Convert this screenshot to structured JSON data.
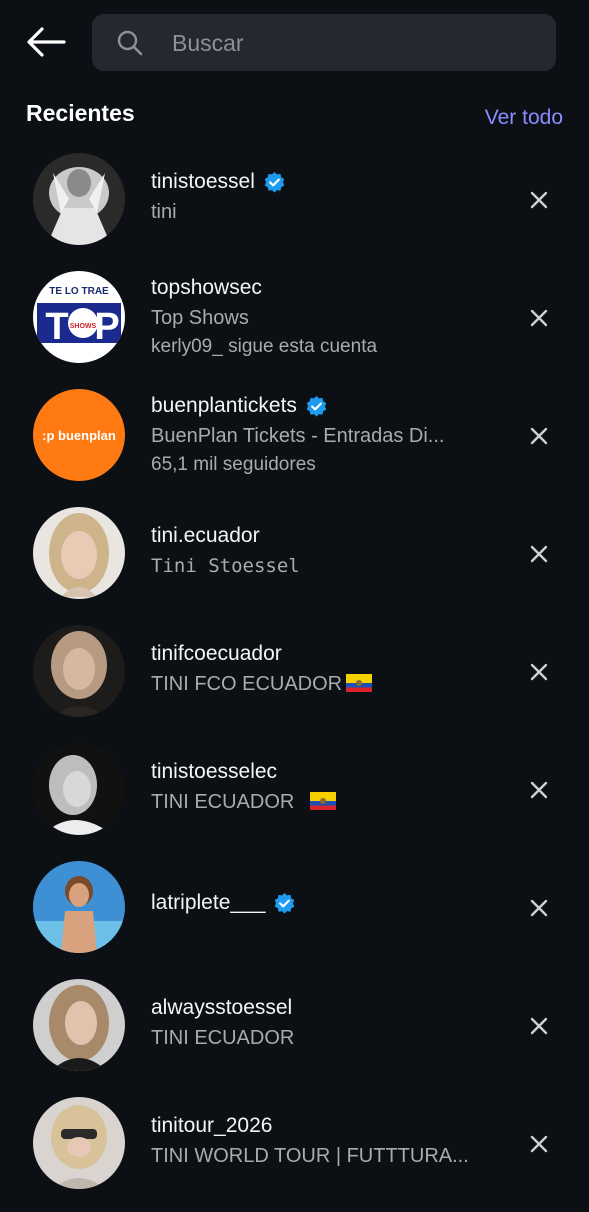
{
  "search": {
    "placeholder": "Buscar"
  },
  "section": {
    "title": "Recientes",
    "see_all": "Ver todo"
  },
  "results": [
    {
      "username": "tinistoessel",
      "subtitle": "tini",
      "verified": true
    },
    {
      "username": "topshowsec",
      "subtitle": "Top Shows",
      "meta": "kerly09_ sigue esta cuenta",
      "avatar_text": [
        "TE LO TRAE",
        "T",
        "P",
        "SHOWS"
      ]
    },
    {
      "username": "buenplantickets",
      "subtitle": "BuenPlan Tickets - Entradas Di...",
      "meta": "65,1 mil seguidores",
      "verified": true,
      "avatar_text": ":p buenplan"
    },
    {
      "username": "tini.ecuador",
      "subtitle": "Tini Stoessel"
    },
    {
      "username": "tinifcoecuador",
      "subtitle": "TINI FCO ECUADOR"
    },
    {
      "username": "tinistoesselec",
      "subtitle": "TINI ECUADOR "
    },
    {
      "username": "latriplete___",
      "verified": true
    },
    {
      "username": "alwaysstoessel",
      "subtitle": "TINI ECUADOR"
    },
    {
      "username": "tinitour_2026",
      "subtitle": "TINI WORLD TOUR | FUTTTURA..."
    }
  ],
  "colors": {
    "background": "#0c0f14",
    "accent_link": "#8a8dff",
    "verified_blue": "#1d9bf0",
    "buenplan_orange": "#ff7a12"
  }
}
